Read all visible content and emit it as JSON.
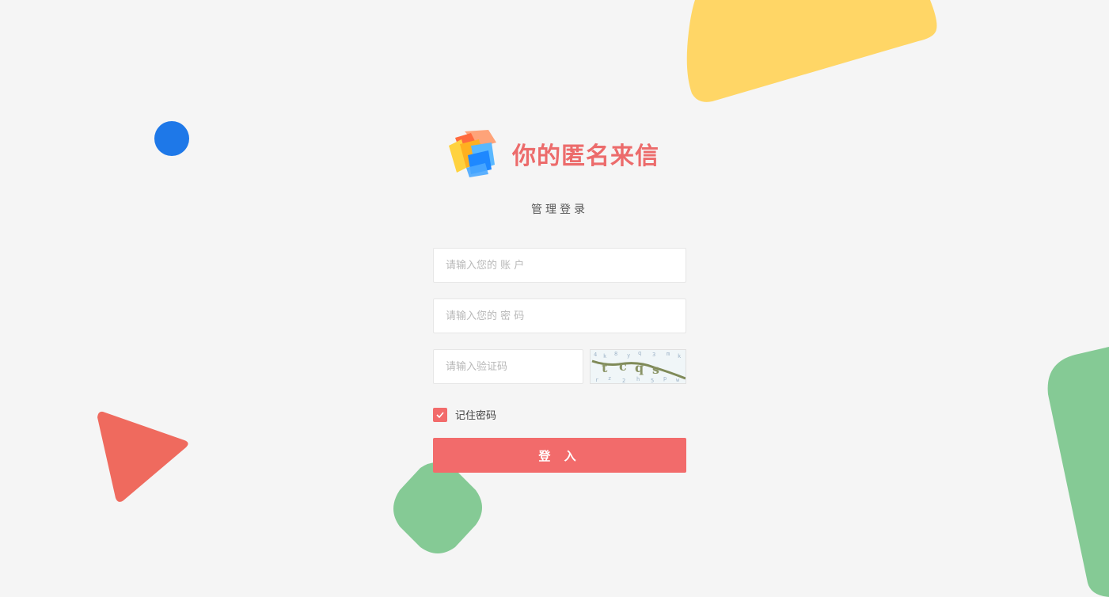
{
  "brand": {
    "title": "你的匿名来信",
    "subtitle": "管理登录"
  },
  "form": {
    "account_placeholder": "请输入您的 账 户",
    "password_placeholder": "请输入您的 密 码",
    "captcha_placeholder": "请输入验证码",
    "remember_label": "记住密码",
    "remember_checked": true,
    "login_label": "登 入"
  },
  "colors": {
    "accent": "#f26b6b",
    "title": "#ec6b6b",
    "background": "#f5f5f5",
    "yellow": "#ffd666",
    "green": "#85ca95",
    "blue": "#1e78e8",
    "red": "#ef6a5e"
  }
}
